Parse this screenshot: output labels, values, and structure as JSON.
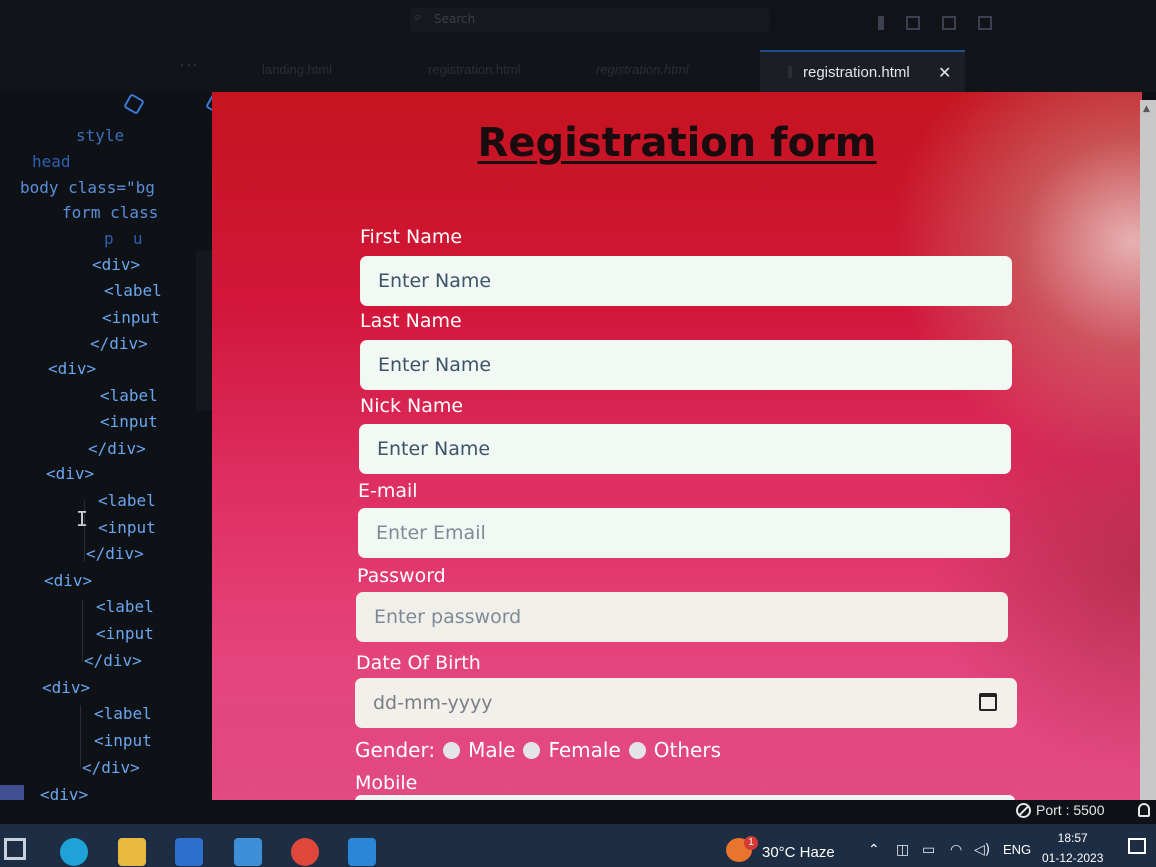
{
  "window": {
    "search_placeholder": "Search"
  },
  "tabs": {
    "ghost": [
      "landing.html",
      "registration.html",
      "registration.html"
    ],
    "active_label": "registration.html",
    "close_glyph": "✕"
  },
  "editor": {
    "lines": [
      {
        "text": "style",
        "cls": "attr"
      },
      {
        "text": "head",
        "cls": "kw"
      },
      {
        "text": "body class=\"bg",
        "cls": "mixed"
      },
      {
        "text": "form class",
        "cls": "mixed"
      },
      {
        "text": "p  u",
        "cls": "kw"
      },
      {
        "text": "<div>",
        "cls": "tag"
      },
      {
        "text": "<label",
        "cls": "tag"
      },
      {
        "text": "<input",
        "cls": "tag"
      },
      {
        "text": "</div>",
        "cls": "tag"
      },
      {
        "text": "<div>",
        "cls": "tag"
      },
      {
        "text": "<label",
        "cls": "tag"
      },
      {
        "text": "<input",
        "cls": "tag"
      },
      {
        "text": "</div>",
        "cls": "tag"
      },
      {
        "text": "<div>",
        "cls": "tag"
      },
      {
        "text": "<label",
        "cls": "tag"
      },
      {
        "text": "<input",
        "cls": "tag"
      },
      {
        "text": "</div>",
        "cls": "tag"
      },
      {
        "text": "<div>",
        "cls": "tag"
      },
      {
        "text": "<label",
        "cls": "tag"
      },
      {
        "text": "<input",
        "cls": "tag"
      },
      {
        "text": "</div>",
        "cls": "tag"
      },
      {
        "text": "<div>",
        "cls": "tag"
      },
      {
        "text": "<label",
        "cls": "tag"
      },
      {
        "text": "<input",
        "cls": "tag"
      },
      {
        "text": "</div>",
        "cls": "tag"
      },
      {
        "text": "<div>",
        "cls": "tag"
      }
    ]
  },
  "form": {
    "title": "Registration form",
    "fields": [
      {
        "label": "First Name",
        "placeholder": "Enter Name"
      },
      {
        "label": "Last Name",
        "placeholder": "Enter Name"
      },
      {
        "label": "Nick Name",
        "placeholder": "Enter Name"
      },
      {
        "label": "E-mail",
        "placeholder": "Enter Email"
      },
      {
        "label": "Password",
        "placeholder": "Enter password"
      }
    ],
    "dob": {
      "label": "Date Of Birth",
      "placeholder": "dd-mm-yyyy"
    },
    "gender": {
      "label": "Gender:",
      "options": [
        "Male",
        "Female",
        "Others"
      ]
    },
    "mobile": {
      "label": "Mobile"
    }
  },
  "statusbar": {
    "port": "Port : 5500"
  },
  "taskbar": {
    "weather_badge": "1",
    "weather": "30°C  Haze",
    "language": "ENG",
    "time": "18:57",
    "date": "01-12-2023"
  },
  "colors": {
    "form_gradient_top": "#c5141f",
    "form_gradient_bottom": "#e24a82",
    "input_bg": "#f2f8f4",
    "taskbar": "#1d2d44",
    "tab_accent": "#1f4f8f"
  }
}
